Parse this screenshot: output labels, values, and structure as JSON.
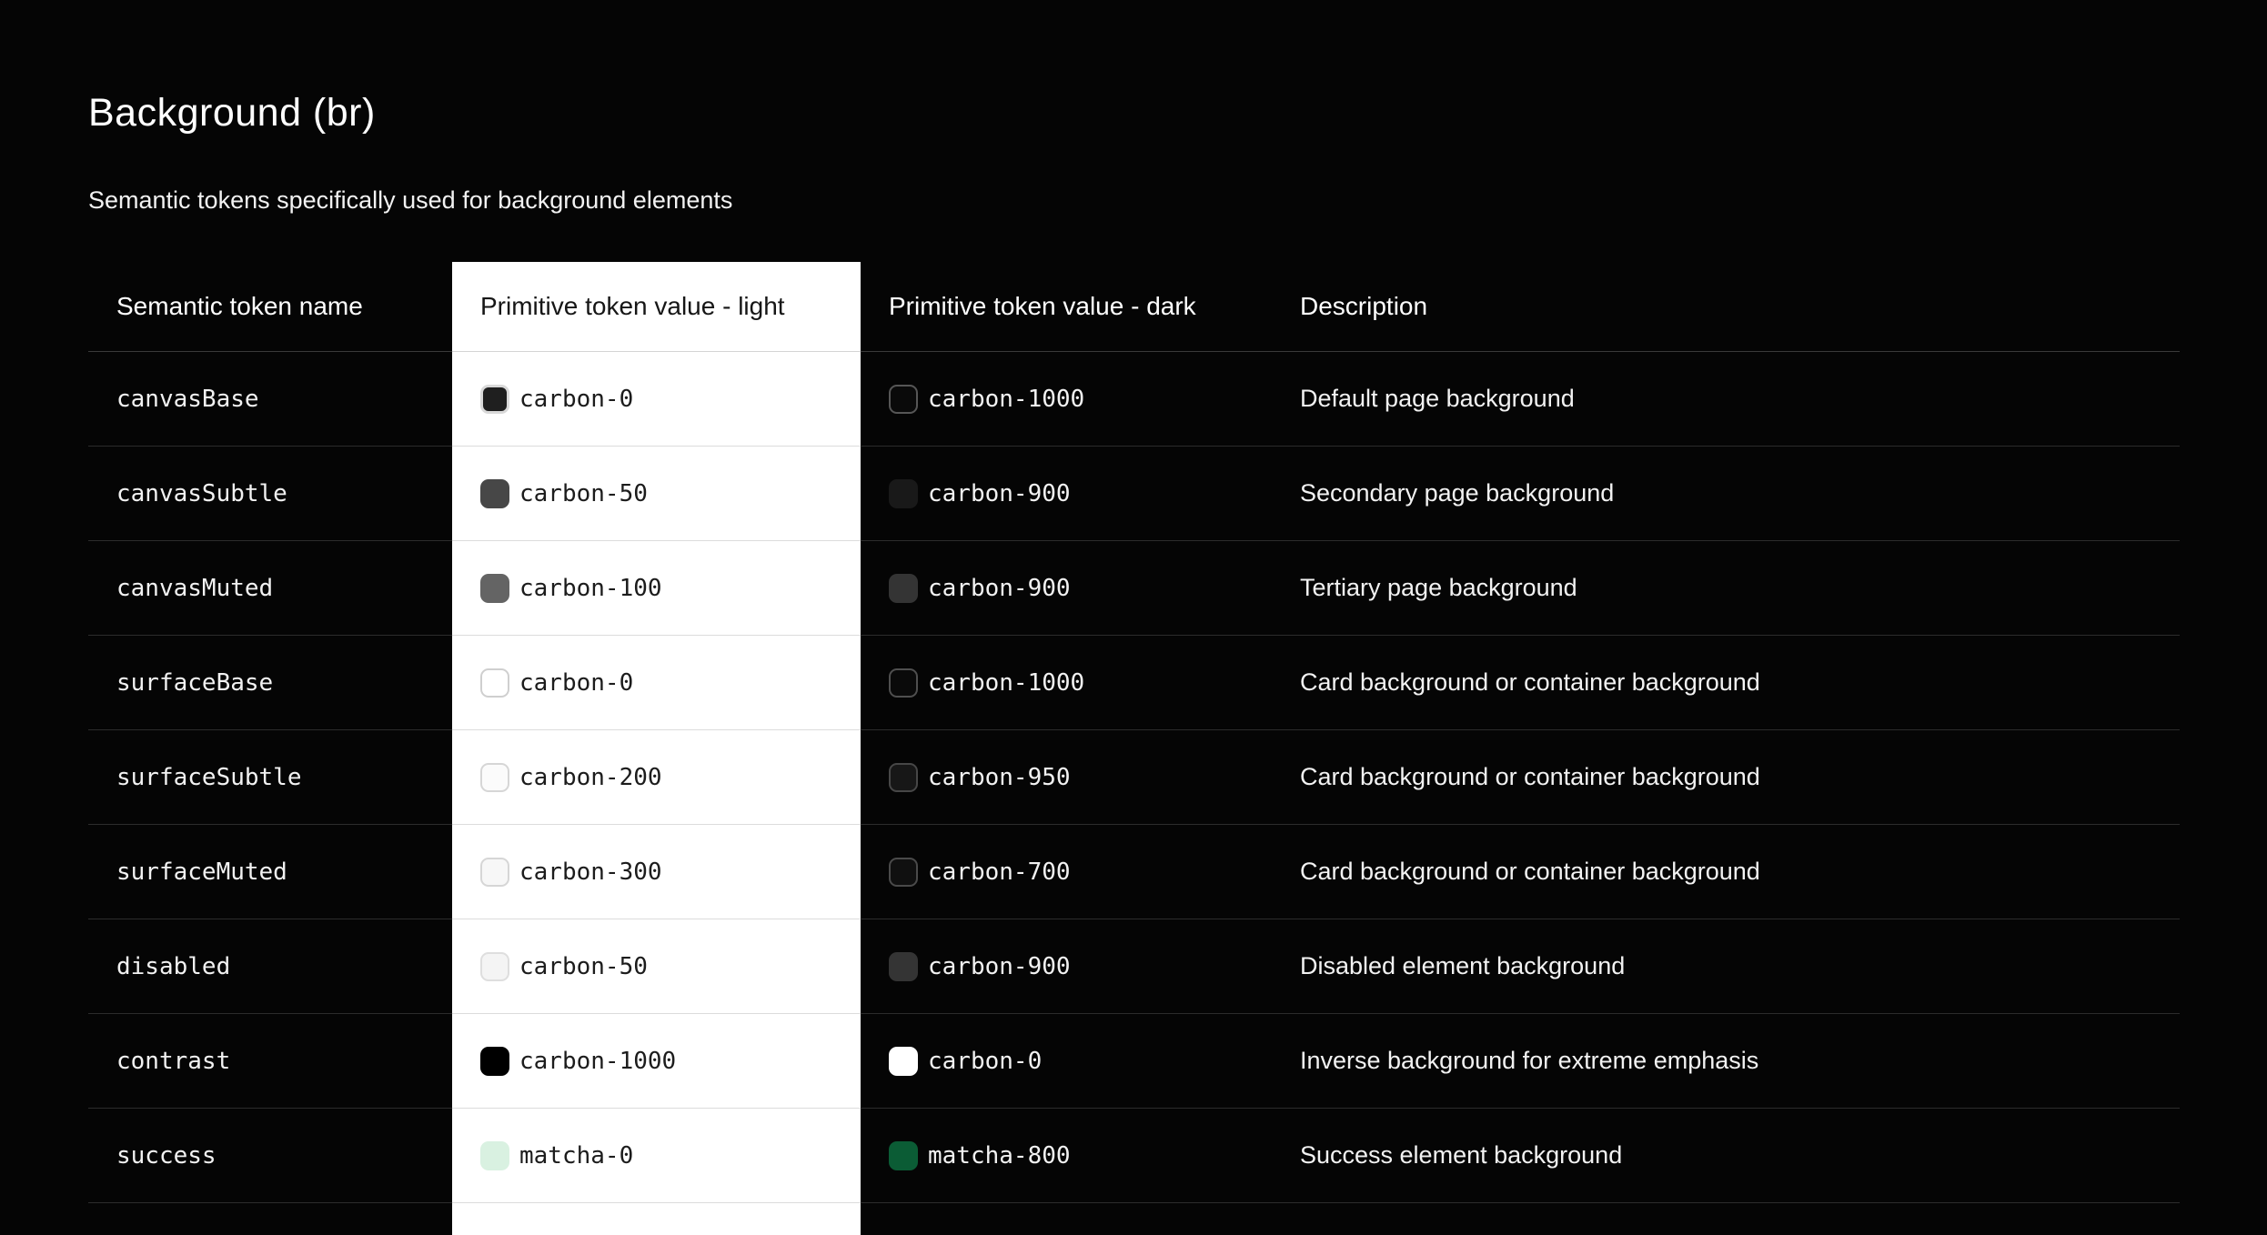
{
  "page": {
    "title": "Background (br)",
    "subtitle": "Semantic tokens specifically used for background elements",
    "background_color": "#050505",
    "light_column_color": "#ffffff"
  },
  "table": {
    "headers": [
      {
        "label": "Semantic token name"
      },
      {
        "label": "Primitive token value - light"
      },
      {
        "label": "Primitive token value - dark"
      },
      {
        "label": "Description"
      }
    ],
    "rows": [
      {
        "token": "canvasBase",
        "light": {
          "label": "carbon-0",
          "swatch": "#1f1f1f",
          "border": "#d9d9d9",
          "borderWidth": 3
        },
        "dark": {
          "label": "carbon-1000",
          "swatch": "#0a0a0a",
          "border": "#565656",
          "borderWidth": 2
        },
        "description": "Default page background"
      },
      {
        "token": "canvasSubtle",
        "light": {
          "label": "carbon-50",
          "swatch": "#474747"
        },
        "dark": {
          "label": "carbon-900",
          "swatch": "#191919"
        },
        "description": "Secondary page background"
      },
      {
        "token": "canvasMuted",
        "light": {
          "label": "carbon-100",
          "swatch": "#646464"
        },
        "dark": {
          "label": "carbon-900",
          "swatch": "#343434"
        },
        "description": "Tertiary page background"
      },
      {
        "token": "surfaceBase",
        "light": {
          "label": "carbon-0",
          "swatch": "#ffffff",
          "border": "#cfcfcf",
          "borderWidth": 2
        },
        "dark": {
          "label": "carbon-1000",
          "swatch": "#0a0a0a",
          "border": "#4f4f4f",
          "borderWidth": 2
        },
        "description": "Card background or container background"
      },
      {
        "token": "surfaceSubtle",
        "light": {
          "label": "carbon-200",
          "swatch": "#fbfbfb",
          "border": "#d6d6d6",
          "borderWidth": 2
        },
        "dark": {
          "label": "carbon-950",
          "swatch": "#171717",
          "border": "#474747",
          "borderWidth": 2
        },
        "description": "Card background or container background"
      },
      {
        "token": "surfaceMuted",
        "light": {
          "label": "carbon-300",
          "swatch": "#f7f7f7",
          "border": "#d6d6d6",
          "borderWidth": 2
        },
        "dark": {
          "label": "carbon-700",
          "swatch": "#101010",
          "border": "#4a4a4a",
          "borderWidth": 2
        },
        "description": "Card background or container background"
      },
      {
        "token": "disabled",
        "light": {
          "label": "carbon-50",
          "swatch": "#f4f4f4",
          "border": "#dedede",
          "borderWidth": 2
        },
        "dark": {
          "label": "carbon-900",
          "swatch": "#343434"
        },
        "description": "Disabled element background"
      },
      {
        "token": "contrast",
        "light": {
          "label": "carbon-1000",
          "swatch": "#000000"
        },
        "dark": {
          "label": "carbon-0",
          "swatch": "#ffffff"
        },
        "description": "Inverse background for extreme emphasis"
      },
      {
        "token": "success",
        "light": {
          "label": "matcha-0",
          "swatch": "#d9f1e1"
        },
        "dark": {
          "label": "matcha-800",
          "swatch": "#0b5c35"
        },
        "description": "Success element background"
      }
    ]
  }
}
